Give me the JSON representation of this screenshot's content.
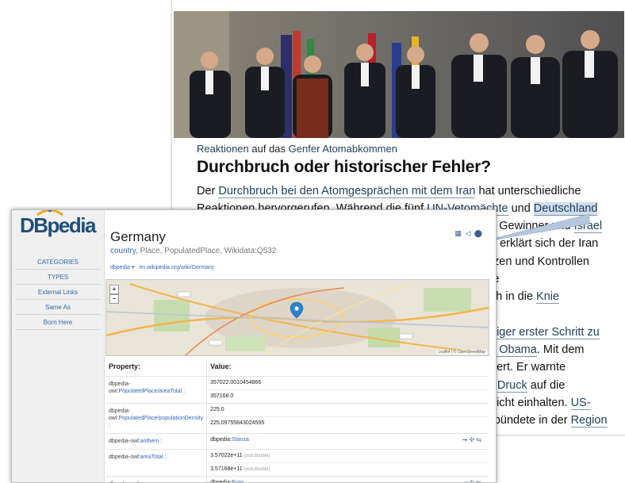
{
  "article": {
    "kicker_link": "Reaktionen",
    "kicker_mid": " auf das ",
    "kicker_link2": "Genfer Atomabkommen",
    "headline": "Durchbruch oder historischer Fehler?",
    "lines": [
      {
        "t": "Der "
      },
      {
        "t": "Durchbruch bei den Atomgesprächen mit dem Iran",
        "link": true
      },
      {
        "t": " hat unterschiedliche"
      },
      {
        "t": "Reaktionen hervorgerufen. Während die fünf "
      },
      {
        "t": "UN-Vetomächte",
        "link": true
      },
      {
        "t": " und "
      },
      {
        "t": "Deutschland",
        "link": true,
        "hl": true
      }
    ],
    "right_lines": [
      {
        "pre": "s Gewinner und ",
        "link": "Israel",
        "post": ""
      },
      {
        "pre": "n erklärt sich der Iran",
        "link": "",
        "post": ""
      },
      {
        "pre": "tzen und Kontrollen",
        "link": "",
        "post": ""
      },
      {
        "pre": "ie",
        "link": "",
        "post": ""
      },
      {
        "pre": "ch in die ",
        "link": "Knie",
        "post": ""
      },
      {
        "pre": "",
        "link": "",
        "post": ""
      },
      {
        "pre": "",
        "link": "eiger erster Schritt zu",
        "post": ""
      },
      {
        "pre": "",
        "link": "k Obama",
        "post": ". Mit dem"
      },
      {
        "pre": "dert. Er warnte",
        "link": "",
        "post": ""
      },
      {
        "pre": "r ",
        "link": "Druck",
        "post": " auf die"
      },
      {
        "pre": "nicht einhalten. ",
        "link": "US-",
        "post": ""
      },
      {
        "pre": "rbündete in der ",
        "link": "Region",
        "post": ""
      }
    ]
  },
  "dbpedia": {
    "logo": "DBpedia",
    "sidebar": [
      "CATEGORIES",
      "TYPES",
      "External Links",
      "Same As",
      "Born Here"
    ],
    "entity": {
      "title": "Germany",
      "type_link": "country",
      "types_rest": ", Place, PopulatedPlace, Wikidata:Q532",
      "link1": "dbpedia ▾",
      "link2": "en.wikipedia.org/wiki/Germany"
    },
    "toolbar_icons": "▦ ◁ ⬤",
    "map": {
      "zoom_in": "+",
      "zoom_out": "−",
      "attribution": "Leaflet | © OpenStreetMap"
    },
    "table": {
      "property_header": "Property:",
      "value_header": "Value:",
      "rows": [
        {
          "prop_prefix": "dbpedia-owl:",
          "prop_link": "PopulatedPlace/areaTotal",
          "prop_suffix": " :",
          "values": [
            {
              "v": "357022.0010454866"
            },
            {
              "v": "357168.0"
            }
          ]
        },
        {
          "prop_prefix": "dbpedia-owl:",
          "prop_link": "PopulatedPlace/populationDensity",
          "prop_suffix": " :",
          "values": [
            {
              "v": "225.0"
            },
            {
              "v": "225.09755843024595"
            }
          ]
        },
        {
          "prop_prefix": "dbpedia-owl:",
          "prop_link": "anthem",
          "prop_suffix": " :",
          "values": [
            {
              "v_prefix": "dbpedia:",
              "v_link": "Stanza",
              "icons": true
            }
          ]
        },
        {
          "prop_prefix": "dbpedia-owl:",
          "prop_link": "areaTotal",
          "prop_suffix": " :",
          "values": [
            {
              "v": "3.57022e+11",
              "suffix": " (xsd:double)"
            },
            {
              "v": "3.57168e+11",
              "suffix": " (xsd:double)"
            }
          ]
        },
        {
          "prop_prefix": "dbpedia-owl:",
          "prop_link": "currency",
          "prop_suffix": " :",
          "values": [
            {
              "v_prefix": "dbpedia:",
              "v_link": "Euro",
              "icons": true
            }
          ]
        }
      ],
      "row_icons": "⇥ ✣ ⇆"
    },
    "colors": {
      "brand": "#1f4f7d",
      "link": "#3366bb",
      "sidebar_bg": "#f0f0f0"
    }
  }
}
